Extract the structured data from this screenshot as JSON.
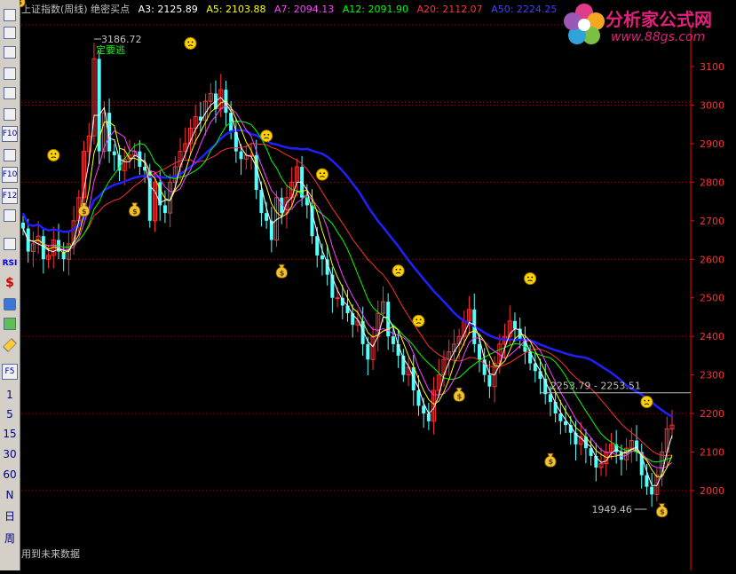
{
  "header": {
    "title": "上证指数(周线) 绝密买点",
    "indicators": [
      {
        "label": "A3: 2125.89",
        "color": "#ffffff"
      },
      {
        "label": "A5: 2103.88",
        "color": "#ffff00"
      },
      {
        "label": "A7: 2094.13",
        "color": "#ff40ff"
      },
      {
        "label": "A12: 2091.90",
        "color": "#00ff00"
      },
      {
        "label": "A20: 2112.07",
        "color": "#ff3030"
      },
      {
        "label": "A50: 2224.25",
        "color": "#2020ff"
      }
    ]
  },
  "logo": {
    "name": "分析家公式网",
    "url": "www.88gs.com"
  },
  "footer": {
    "text": "用到未来数据"
  },
  "toolbar": {
    "buttons": [
      {
        "name": "daily-icon",
        "label": ""
      },
      {
        "name": "table-icon",
        "label": ""
      },
      {
        "name": "grid-icon",
        "label": ""
      },
      {
        "name": "line-chart-icon",
        "label": ""
      },
      {
        "name": "candle-chart-icon",
        "label": ""
      },
      {
        "name": "window-icon",
        "label": ""
      },
      {
        "name": "f10-icon",
        "label": "F10"
      },
      {
        "name": "news-icon",
        "label": ""
      },
      {
        "name": "f11-icon",
        "label": "F10"
      },
      {
        "name": "f12-icon",
        "label": "F12"
      },
      {
        "name": "search-icon",
        "label": ""
      },
      {
        "name": "wave-icon",
        "label": ""
      },
      {
        "name": "rsi-icon",
        "label": "RSI"
      },
      {
        "name": "dollar-icon",
        "label": "$"
      },
      {
        "name": "move-icon",
        "label": ""
      },
      {
        "name": "export-icon",
        "label": ""
      },
      {
        "name": "pencil-icon",
        "label": ""
      },
      {
        "name": "f5-icon",
        "label": "F5"
      }
    ],
    "periods": [
      "1",
      "5",
      "15",
      "30",
      "60",
      "N",
      "日",
      "周"
    ]
  },
  "colors": {
    "up": "#ff3232",
    "down": "#54ffff",
    "ma50": "#2020ff",
    "grid": "#a00000",
    "axis": "#ff0000",
    "axis_label": "#ff3030"
  },
  "chart_data": {
    "type": "candlestick",
    "y_axis": {
      "ticks": [
        2000,
        2100,
        2200,
        2300,
        2400,
        2500,
        2600,
        2700,
        2800,
        2900,
        3000,
        3100
      ]
    },
    "annotations": {
      "high": {
        "label": "3186.72",
        "value": 3186.72
      },
      "high_text": "定要逃",
      "low": {
        "label": "1949.46",
        "value": 1949.46
      },
      "hline": {
        "label": "2253.79 - 2253.51",
        "value": 2253.79
      }
    },
    "closes": [
      2680,
      2620,
      2640,
      2660,
      2600,
      2610,
      2650,
      2620,
      2600,
      2640,
      2700,
      2760,
      2880,
      2920,
      3120,
      2880,
      2980,
      2880,
      2870,
      2830,
      2860,
      2870,
      2880,
      2840,
      2830,
      2700,
      2800,
      2740,
      2720,
      2800,
      2840,
      2880,
      2900,
      2940,
      2970,
      2960,
      3010,
      3030,
      2990,
      3040,
      2980,
      2930,
      2880,
      2860,
      2870,
      2870,
      2780,
      2720,
      2700,
      2650,
      2760,
      2720,
      2760,
      2800,
      2840,
      2760,
      2740,
      2660,
      2610,
      2600,
      2560,
      2500,
      2500,
      2480,
      2460,
      2430,
      2440,
      2380,
      2340,
      2400,
      2460,
      2490,
      2400,
      2380,
      2350,
      2300,
      2320,
      2260,
      2220,
      2200,
      2180,
      2260,
      2300,
      2340,
      2360,
      2380,
      2400,
      2440,
      2470,
      2380,
      2340,
      2300,
      2270,
      2330,
      2380,
      2400,
      2440,
      2420,
      2390,
      2360,
      2330,
      2310,
      2290,
      2250,
      2230,
      2200,
      2180,
      2170,
      2150,
      2120,
      2140,
      2110,
      2090,
      2060,
      2070,
      2100,
      2120,
      2100,
      2080,
      2110,
      2130,
      2100,
      2040,
      2010,
      1990,
      2040,
      2100,
      2160,
      2170
    ],
    "buy_signals": [
      12,
      22,
      51,
      86,
      104,
      126,
      139
    ],
    "sell_signals": [
      6,
      33,
      48,
      59,
      74,
      78,
      100,
      123
    ]
  }
}
